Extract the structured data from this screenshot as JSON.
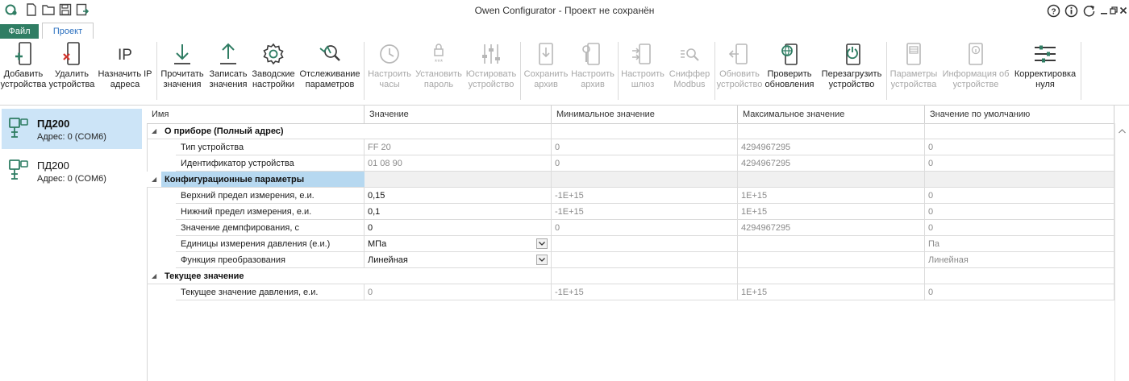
{
  "window": {
    "title": "Owen Configurator - Проект не сохранён"
  },
  "tabs": {
    "file": "Файл",
    "project": "Проект"
  },
  "ribbon": {
    "add_device": "Добавить\nустройства",
    "delete_device": "Удалить\nустройства",
    "assign_ip": "Назначить IP\nадреса",
    "read_values": "Прочитать\nзначения",
    "write_values": "Записать\nзначения",
    "factory_settings": "Заводские\nнастройки",
    "track_params": "Отслеживание\nпараметров",
    "set_clock": "Настроить\nчасы",
    "set_password": "Установить\nпароль",
    "adjust_device": "Юстировать\nустройство",
    "save_archive": "Сохранить\nархив",
    "config_archive": "Настроить\nархив",
    "config_gateway": "Настроить\nшлюз",
    "modbus_sniffer": "Сниффер\nModbus",
    "update_device": "Обновить\nустройство",
    "check_updates": "Проверить\nобновления",
    "reboot_device": "Перезагрузить\nустройство",
    "device_params": "Параметры\nустройства",
    "device_info": "Информация об\nустройстве",
    "zero_correction": "Корректировка\nнуля"
  },
  "devices": [
    {
      "name": "ПД200",
      "address": "Адрес: 0 (COM6)"
    },
    {
      "name": "ПД200",
      "address": "Адрес: 0 (COM6)"
    }
  ],
  "grid": {
    "columns": [
      "Имя",
      "Значение",
      "Минимальное значение",
      "Максимальное значение",
      "Значение по умолчанию"
    ],
    "groups": [
      {
        "title": "О приборе (Полный адрес)",
        "rows": [
          {
            "name": "Тип устройства",
            "value": "FF 20",
            "min": "0",
            "max": "4294967295",
            "default": "0"
          },
          {
            "name": "Идентификатор устройства",
            "value": "01 08 90",
            "min": "0",
            "max": "4294967295",
            "default": "0"
          }
        ]
      },
      {
        "title": "Конфигурационные параметры",
        "rows": [
          {
            "name": "Верхний предел измерения, е.и.",
            "value": "0,15",
            "min": "-1E+15",
            "max": "1E+15",
            "default": "0"
          },
          {
            "name": "Нижний предел измерения, е.и.",
            "value": "0,1",
            "min": "-1E+15",
            "max": "1E+15",
            "default": "0"
          },
          {
            "name": "Значение демпфирования, с",
            "value": "0",
            "min": "0",
            "max": "4294967295",
            "default": "0"
          },
          {
            "name": "Единицы измерения давления (е.и.)",
            "value": "МПа",
            "min": "",
            "max": "",
            "default": "Па"
          },
          {
            "name": "Функция преобразования",
            "value": "Линейная",
            "min": "",
            "max": "",
            "default": "Линейная"
          }
        ]
      },
      {
        "title": "Текущее значение",
        "rows": [
          {
            "name": "Текущее значение давления, е.и.",
            "value": "0",
            "min": "-1E+15",
            "max": "1E+15",
            "default": "0"
          }
        ]
      }
    ]
  },
  "colors": {
    "accent": "#2f7d63",
    "selection": "#cce4f7",
    "group_selected": "#b6d8f0"
  }
}
